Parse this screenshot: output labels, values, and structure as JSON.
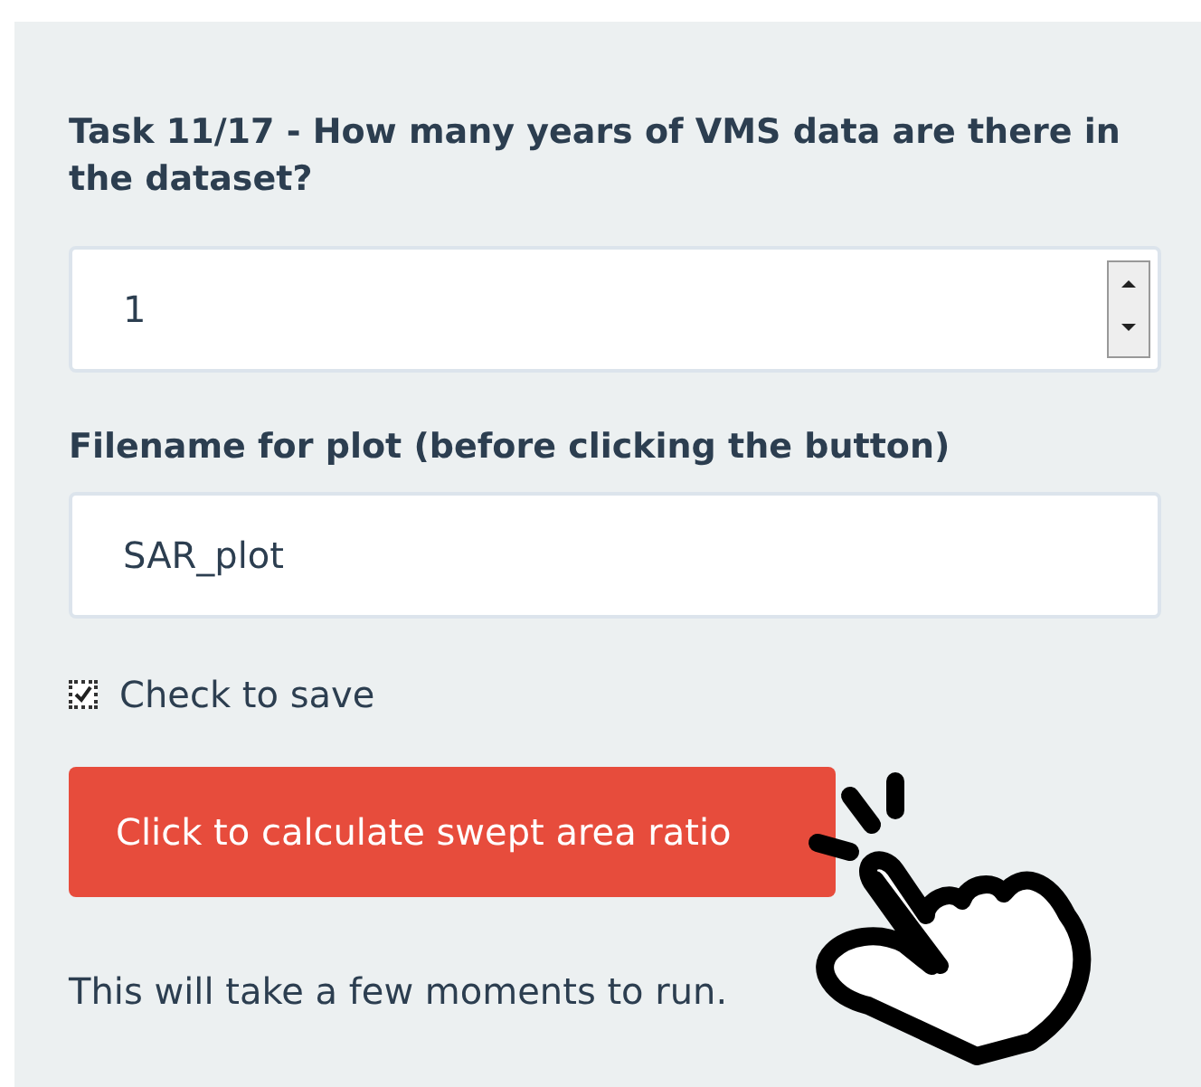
{
  "question": {
    "title": "Task 11/17 - How many years of VMS data are there in the dataset?",
    "value": "1"
  },
  "filename": {
    "label": "Filename for plot (before clicking the button)",
    "value": "SAR_plot"
  },
  "save_checkbox": {
    "label": "Check to save",
    "checked": true
  },
  "calculate_button": {
    "label": "Click to calculate swept area ratio"
  },
  "note": "This will take a few moments to run."
}
